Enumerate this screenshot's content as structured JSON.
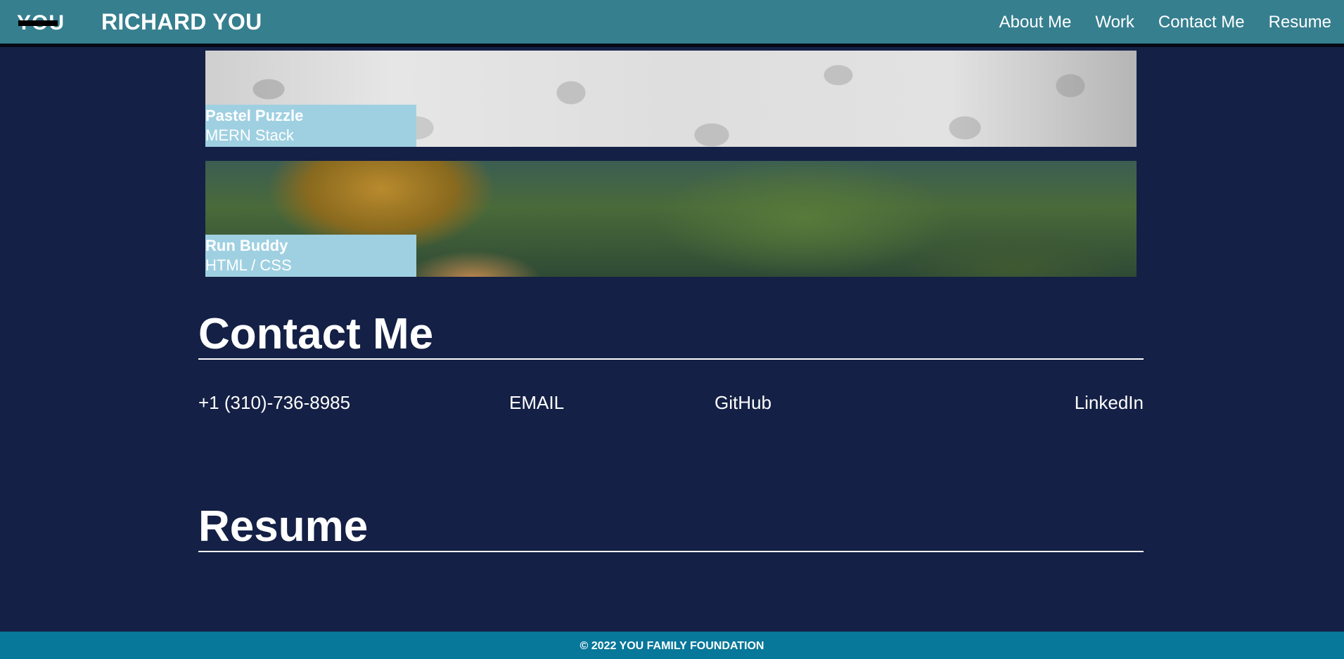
{
  "header": {
    "logo_text": "YOU",
    "brand_name": "RICHARD YOU",
    "nav": [
      {
        "label": "About Me"
      },
      {
        "label": "Work"
      },
      {
        "label": "Contact Me"
      },
      {
        "label": "Resume"
      }
    ]
  },
  "projects": [
    {
      "title": "Pastel Puzzle",
      "tech": "MERN Stack"
    },
    {
      "title": "Run Buddy",
      "tech": "HTML / CSS"
    }
  ],
  "contact": {
    "heading": "Contact Me",
    "phone": "+1 (310)-736-8985",
    "email": "EMAIL",
    "github": "GitHub",
    "linkedin": "LinkedIn"
  },
  "resume": {
    "heading": "Resume"
  },
  "footer": {
    "text": "© 2022 YOU FAMILY FOUNDATION"
  },
  "colors": {
    "header_bg": "#367f8f",
    "page_bg": "#142045",
    "label_bg": "#9fd0e1",
    "footer_bg": "#07779a"
  }
}
